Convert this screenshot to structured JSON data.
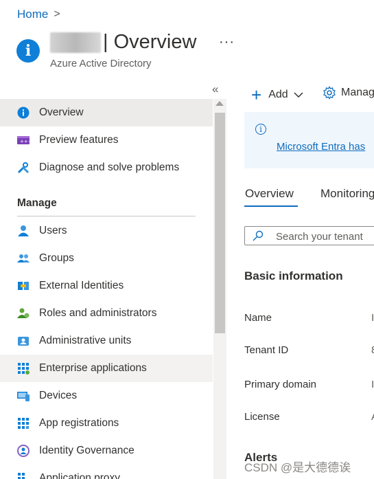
{
  "breadcrumb": {
    "home": "Home",
    "separator": ">"
  },
  "header": {
    "title": "| Overview",
    "subtitle": "Azure Active Directory",
    "more": "···"
  },
  "sidebar": {
    "collapse": "«",
    "top_items": [
      {
        "label": "Overview"
      },
      {
        "label": "Preview features"
      },
      {
        "label": "Diagnose and solve problems"
      }
    ],
    "section": "Manage",
    "items": [
      {
        "label": "Users"
      },
      {
        "label": "Groups"
      },
      {
        "label": "External Identities"
      },
      {
        "label": "Roles and administrators"
      },
      {
        "label": "Administrative units"
      },
      {
        "label": "Enterprise applications"
      },
      {
        "label": "Devices"
      },
      {
        "label": "App registrations"
      },
      {
        "label": "Identity Governance"
      },
      {
        "label": "Application proxy"
      }
    ]
  },
  "toolbar": {
    "add": "Add",
    "manage": "Manag"
  },
  "banner": {
    "link": "Microsoft Entra has"
  },
  "tabs": [
    {
      "label": "Overview"
    },
    {
      "label": "Monitoring"
    }
  ],
  "search": {
    "placeholder": "Search your tenant"
  },
  "basic_info": {
    "heading": "Basic information",
    "rows": [
      {
        "label": "Name",
        "value": "I"
      },
      {
        "label": "Tenant ID",
        "value": "8"
      },
      {
        "label": "Primary domain",
        "value": "I"
      },
      {
        "label": "License",
        "value": "A"
      }
    ]
  },
  "alerts": {
    "heading": "Alerts"
  },
  "watermark": "CSDN @是大德德诶",
  "colors": {
    "accent": "#0f6cbd",
    "active_bg": "#edebe9",
    "banner_bg": "#eff6fc"
  }
}
